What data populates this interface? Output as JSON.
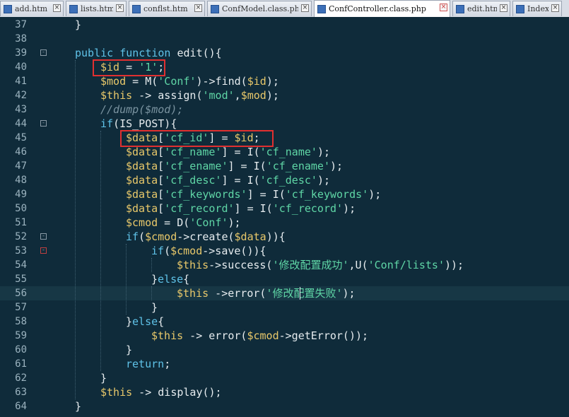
{
  "tabs": [
    {
      "label": "add.htm",
      "active": false
    },
    {
      "label": "lists.htm",
      "active": false
    },
    {
      "label": "conflst.htm",
      "active": false
    },
    {
      "label": "ConfModel.class.php",
      "active": false
    },
    {
      "label": "ConfController.class.php",
      "active": true
    },
    {
      "label": "edit.htm",
      "active": false
    },
    {
      "label": "IndexCo",
      "active": false
    }
  ],
  "icons": {
    "file": "php-file-icon",
    "close": "close-tab-icon"
  },
  "colors": {
    "background": "#0f2b3a",
    "keyword": "#5fc2e8",
    "variable": "#e8c86a",
    "string": "#5fd6a6",
    "highlight_box": "#e03030"
  },
  "lines": [
    {
      "num": "37",
      "indent": 1,
      "tokens": [
        [
          "p",
          "}"
        ]
      ]
    },
    {
      "num": "38",
      "indent": 0,
      "tokens": []
    },
    {
      "num": "39",
      "indent": 1,
      "fold": "-",
      "tokens": [
        [
          "kw",
          "public"
        ],
        [
          "p",
          " "
        ],
        [
          "kw",
          "function"
        ],
        [
          "p",
          " edit(){"
        ]
      ]
    },
    {
      "num": "40",
      "indent": 2,
      "tokens": [
        [
          "var",
          "$id"
        ],
        [
          "p",
          " = "
        ],
        [
          "str",
          "'1'"
        ],
        [
          "p",
          ";"
        ]
      ]
    },
    {
      "num": "41",
      "indent": 2,
      "tokens": [
        [
          "var",
          "$mod"
        ],
        [
          "p",
          " = M("
        ],
        [
          "str",
          "'Conf'"
        ],
        [
          "p",
          ")->find("
        ],
        [
          "var",
          "$id"
        ],
        [
          "p",
          ");"
        ]
      ]
    },
    {
      "num": "42",
      "indent": 2,
      "tokens": [
        [
          "var",
          "$this"
        ],
        [
          "p",
          " -> assign("
        ],
        [
          "str",
          "'mod'"
        ],
        [
          "p",
          ","
        ],
        [
          "var",
          "$mod"
        ],
        [
          "p",
          ");"
        ]
      ]
    },
    {
      "num": "43",
      "indent": 2,
      "tokens": [
        [
          "cmt",
          "//dump($mod);"
        ]
      ]
    },
    {
      "num": "44",
      "indent": 2,
      "fold": "-",
      "tokens": [
        [
          "kw",
          "if"
        ],
        [
          "p",
          "(IS_POST){"
        ]
      ]
    },
    {
      "num": "45",
      "indent": 3,
      "tokens": [
        [
          "var",
          "$data"
        ],
        [
          "p",
          "["
        ],
        [
          "str",
          "'cf_id'"
        ],
        [
          "p",
          "] = "
        ],
        [
          "var",
          "$id"
        ],
        [
          "p",
          ";"
        ]
      ]
    },
    {
      "num": "46",
      "indent": 3,
      "tokens": [
        [
          "var",
          "$data"
        ],
        [
          "p",
          "["
        ],
        [
          "str",
          "'cf_name'"
        ],
        [
          "p",
          "] = I("
        ],
        [
          "str",
          "'cf_name'"
        ],
        [
          "p",
          ");"
        ]
      ]
    },
    {
      "num": "47",
      "indent": 3,
      "tokens": [
        [
          "var",
          "$data"
        ],
        [
          "p",
          "["
        ],
        [
          "str",
          "'cf_ename'"
        ],
        [
          "p",
          "] = I("
        ],
        [
          "str",
          "'cf_ename'"
        ],
        [
          "p",
          ");"
        ]
      ]
    },
    {
      "num": "48",
      "indent": 3,
      "tokens": [
        [
          "var",
          "$data"
        ],
        [
          "p",
          "["
        ],
        [
          "str",
          "'cf_desc'"
        ],
        [
          "p",
          "] = I("
        ],
        [
          "str",
          "'cf_desc'"
        ],
        [
          "p",
          ");"
        ]
      ]
    },
    {
      "num": "49",
      "indent": 3,
      "tokens": [
        [
          "var",
          "$data"
        ],
        [
          "p",
          "["
        ],
        [
          "str",
          "'cf_keywords'"
        ],
        [
          "p",
          "] = I("
        ],
        [
          "str",
          "'cf_keywords'"
        ],
        [
          "p",
          ");"
        ]
      ]
    },
    {
      "num": "50",
      "indent": 3,
      "tokens": [
        [
          "var",
          "$data"
        ],
        [
          "p",
          "["
        ],
        [
          "str",
          "'cf_record'"
        ],
        [
          "p",
          "] = I("
        ],
        [
          "str",
          "'cf_record'"
        ],
        [
          "p",
          ");"
        ]
      ]
    },
    {
      "num": "51",
      "indent": 3,
      "tokens": [
        [
          "var",
          "$cmod"
        ],
        [
          "p",
          " = D("
        ],
        [
          "str",
          "'Conf'"
        ],
        [
          "p",
          ");"
        ]
      ]
    },
    {
      "num": "52",
      "indent": 3,
      "fold": "-",
      "tokens": [
        [
          "kw",
          "if"
        ],
        [
          "p",
          "("
        ],
        [
          "var",
          "$cmod"
        ],
        [
          "p",
          "->create("
        ],
        [
          "var",
          "$data"
        ],
        [
          "p",
          ")){"
        ]
      ]
    },
    {
      "num": "53",
      "indent": 4,
      "fold": "-",
      "foldRed": true,
      "tokens": [
        [
          "kw",
          "if"
        ],
        [
          "p",
          "("
        ],
        [
          "var",
          "$cmod"
        ],
        [
          "p",
          "->save()){"
        ]
      ]
    },
    {
      "num": "54",
      "indent": 5,
      "tokens": [
        [
          "var",
          "$this"
        ],
        [
          "p",
          "->success("
        ],
        [
          "str",
          "'修改配置成功'"
        ],
        [
          "p",
          ",U("
        ],
        [
          "str",
          "'Conf/lists'"
        ],
        [
          "p",
          "));"
        ]
      ]
    },
    {
      "num": "55",
      "indent": 4,
      "tokens": [
        [
          "p",
          "}"
        ],
        [
          "kw",
          "else"
        ],
        [
          "p",
          "{"
        ]
      ]
    },
    {
      "num": "56",
      "indent": 5,
      "current": true,
      "tokens": [
        [
          "var",
          "$this"
        ],
        [
          "p",
          " ->error("
        ],
        [
          "str",
          "'修改配置失败'"
        ],
        [
          "p",
          ");"
        ]
      ]
    },
    {
      "num": "57",
      "indent": 4,
      "tokens": [
        [
          "p",
          "}"
        ]
      ]
    },
    {
      "num": "58",
      "indent": 3,
      "tokens": [
        [
          "p",
          "}"
        ],
        [
          "kw",
          "else"
        ],
        [
          "p",
          "{"
        ]
      ]
    },
    {
      "num": "59",
      "indent": 4,
      "tokens": [
        [
          "var",
          "$this"
        ],
        [
          "p",
          " -> error("
        ],
        [
          "var",
          "$cmod"
        ],
        [
          "p",
          "->getError());"
        ]
      ]
    },
    {
      "num": "60",
      "indent": 3,
      "tokens": [
        [
          "p",
          "}"
        ]
      ]
    },
    {
      "num": "61",
      "indent": 3,
      "tokens": [
        [
          "kw",
          "return"
        ],
        [
          "p",
          ";"
        ]
      ]
    },
    {
      "num": "62",
      "indent": 2,
      "tokens": [
        [
          "p",
          "}"
        ]
      ]
    },
    {
      "num": "63",
      "indent": 2,
      "tokens": [
        [
          "var",
          "$this"
        ],
        [
          "p",
          " -> display();"
        ]
      ]
    },
    {
      "num": "64",
      "indent": 1,
      "tokens": [
        [
          "p",
          "}"
        ]
      ]
    }
  ]
}
